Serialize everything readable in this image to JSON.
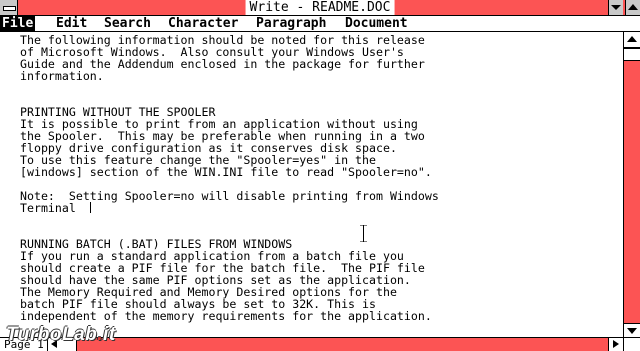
{
  "window": {
    "title": "Write - README.DOC",
    "accent_color": "#fc5454"
  },
  "menu": {
    "items": [
      "File",
      "Edit",
      "Search",
      "Character",
      "Paragraph",
      "Document"
    ]
  },
  "document": {
    "text": "The following information should be noted for this release\nof Microsoft Windows.  Also consult your Windows User's\nGuide and the Addendum enclosed in the package for further\ninformation.\n\n\nPRINTING WITHOUT THE SPOOLER\nIt is possible to print from an application without using\nthe Spooler.  This may be preferable when running in a two\nfloppy drive configuration as it conserves disk space.\nTo use this feature change the \"Spooler=yes\" in the\n[windows] section of the WIN.INI file to read \"Spooler=no\".\n\nNote:  Setting Spooler=no will disable printing from Windows\nTerminal\n\n\nRUNNING BATCH (.BAT) FILES FROM WINDOWS\nIf you run a standard application from a batch file you\nshould create a PIF file for the batch file.  The PIF file\nshould have the same PIF options set as the application.\nThe Memory Required and Memory Desired options for the\nbatch PIF file should always be set to 32K. This is\nindependent of the memory requirements for the application."
  },
  "status": {
    "page": "Page 1"
  },
  "watermark": {
    "prefix": "TurboLab",
    "dot": ".",
    "suffix": "it"
  }
}
